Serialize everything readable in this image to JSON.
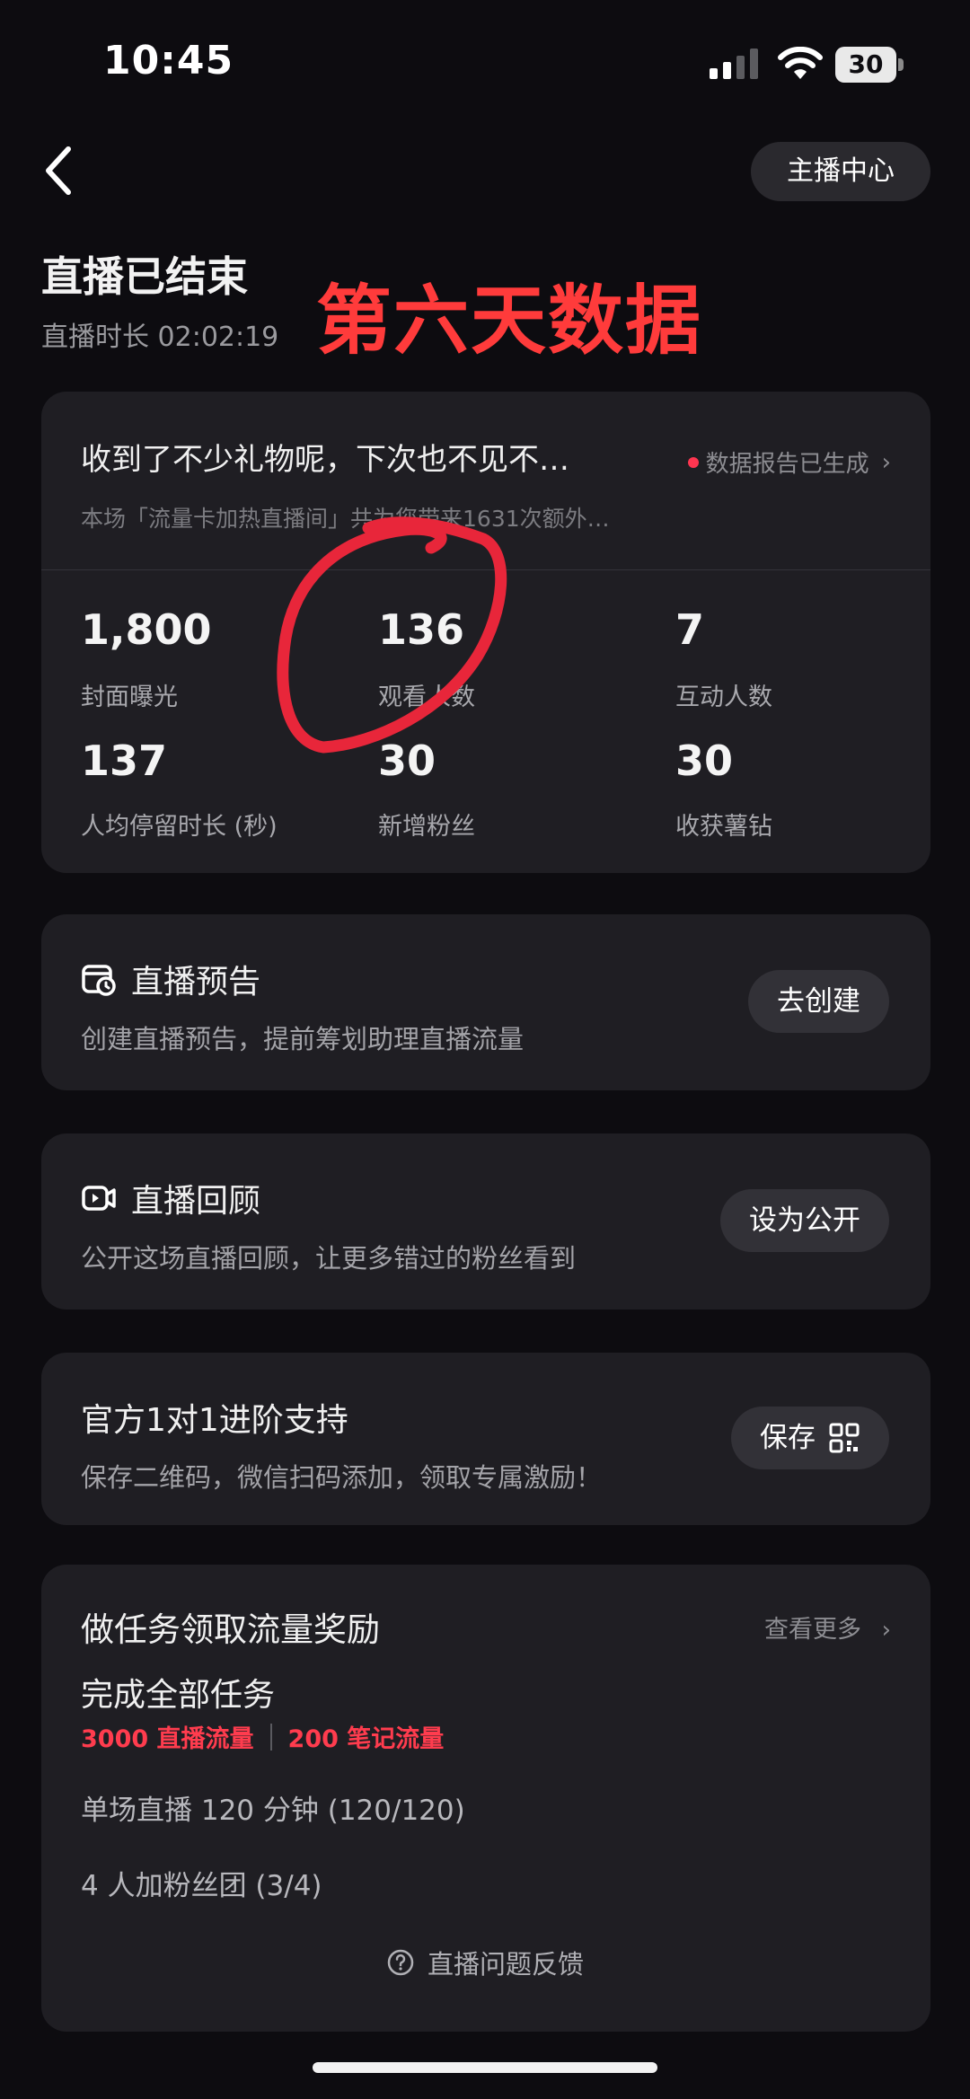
{
  "status_bar": {
    "time": "10:45",
    "battery": "30"
  },
  "header": {
    "back_icon": "chevron-left-icon",
    "host_center_label": "主播中心",
    "title": "直播已结束",
    "duration": "直播时长 02:02:19",
    "annotation": "第六天数据"
  },
  "summary": {
    "message": "收到了不少礼物呢，下次也不见不…",
    "report_link": "数据报告已生成",
    "sub_text": "本场「流量卡加热直播间」共为您带来1631次额外…",
    "stats": [
      {
        "value": "1,800",
        "label": "封面曝光"
      },
      {
        "value": "136",
        "label": "观看人数"
      },
      {
        "value": "7",
        "label": "互动人数"
      },
      {
        "value": "137",
        "label": "人均停留时长 (秒)"
      },
      {
        "value": "30",
        "label": "新增粉丝"
      },
      {
        "value": "30",
        "label": "收获薯钻"
      }
    ]
  },
  "actions": [
    {
      "icon": "calendar-clock-icon",
      "title": "直播预告",
      "desc": "创建直播预告，提前筹划助理直播流量",
      "button": "去创建"
    },
    {
      "icon": "video-replay-icon",
      "title": "直播回顾",
      "desc": "公开这场直播回顾，让更多错过的粉丝看到",
      "button": "设为公开"
    },
    {
      "icon": "",
      "title": "官方1对1进阶支持",
      "desc": "保存二维码，微信扫码添加，领取专属激励！",
      "button": "保存",
      "button_icon": "qr-code-icon"
    }
  ],
  "tasks": {
    "title": "做任务领取流量奖励",
    "more": "查看更多",
    "all_tasks": "完成全部任务",
    "reward_1": "3000 直播流量",
    "reward_2": "200 笔记流量",
    "items": [
      "单场直播 120 分钟 (120/120)",
      "4 人加粉丝团 (3/4)"
    ]
  },
  "footer": {
    "feedback": "直播问题反馈",
    "feedback_icon": "question-circle-icon"
  },
  "colors": {
    "background": "#0d0c10",
    "card": "#1f1e23",
    "accent_red": "#ff3c4e",
    "annotation_red": "#ff3b3b"
  }
}
